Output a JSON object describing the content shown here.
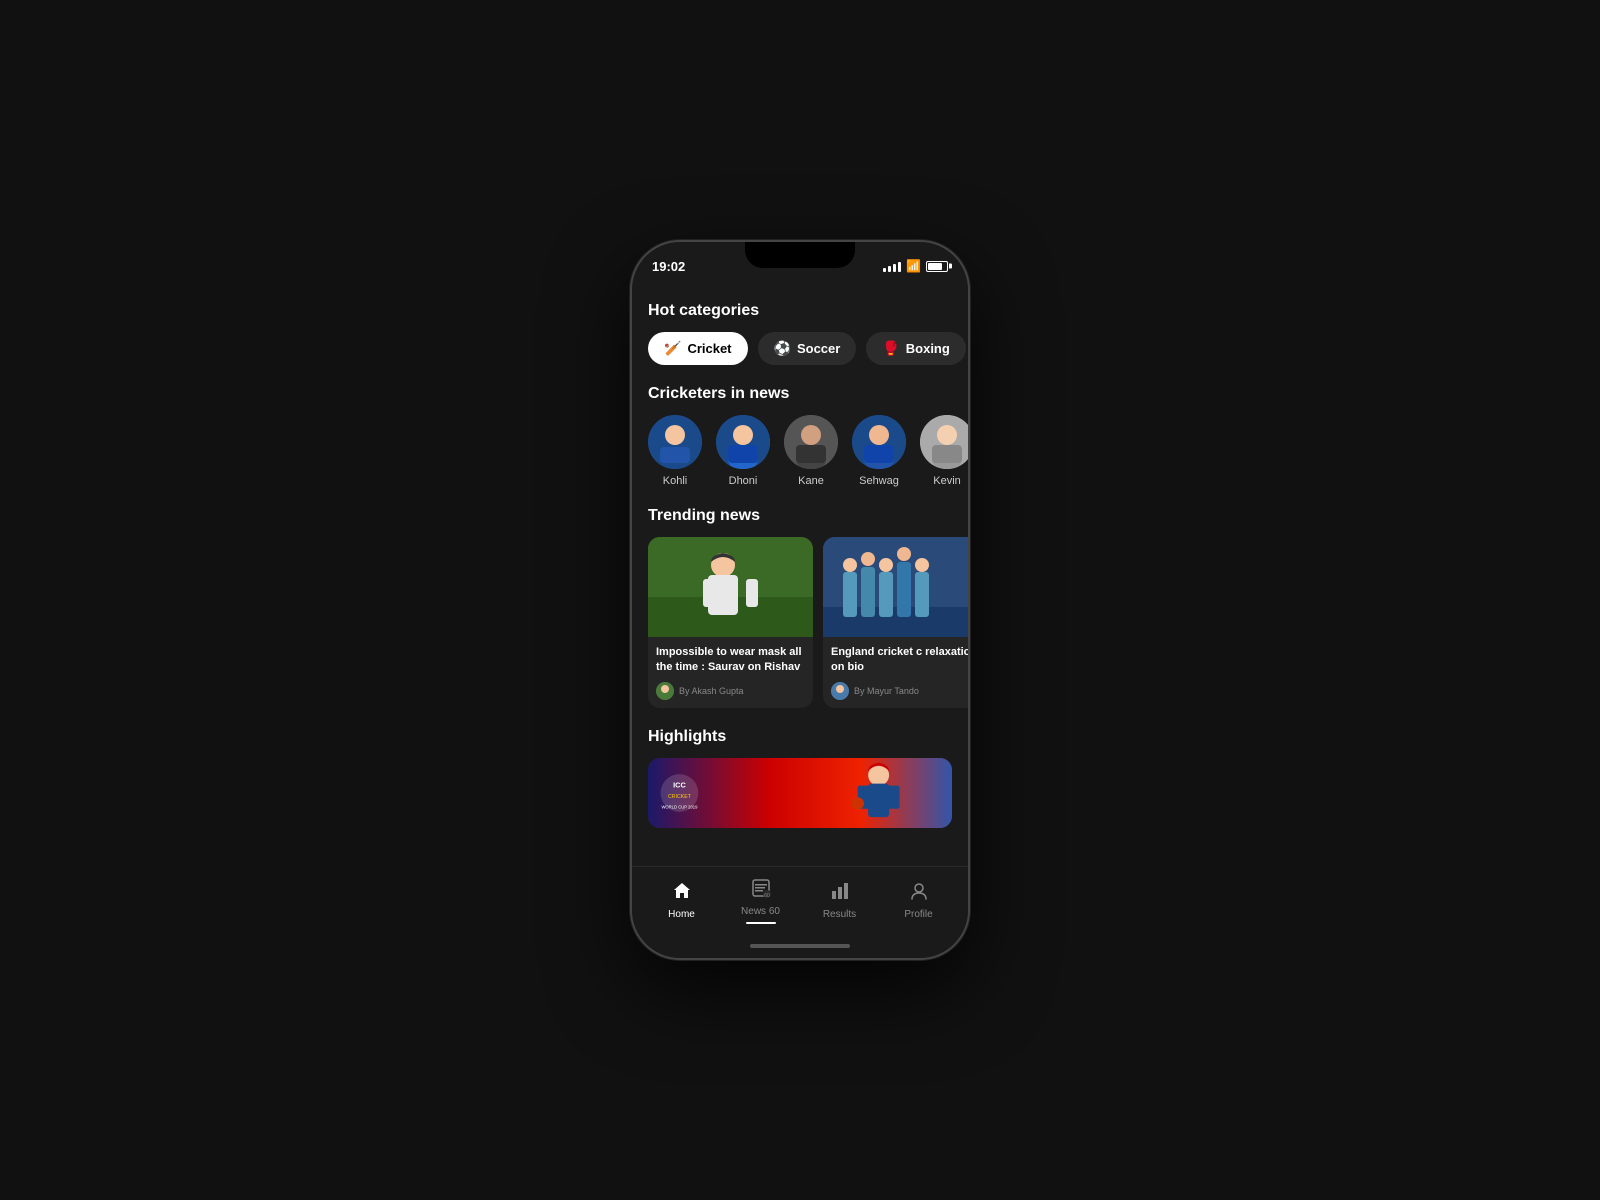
{
  "statusBar": {
    "time": "19:02"
  },
  "header": {
    "hotCategories": "Hot categories"
  },
  "categories": [
    {
      "id": "cricket",
      "label": "Cricket",
      "icon": "🏏",
      "active": true
    },
    {
      "id": "soccer",
      "label": "Soccer",
      "icon": "⚽",
      "active": false
    },
    {
      "id": "boxing",
      "label": "Boxing",
      "icon": "🥊",
      "active": false
    }
  ],
  "cricketersSection": {
    "title": "Cricketers in news",
    "players": [
      {
        "name": "Kohli",
        "avatarClass": "avatar-kohli"
      },
      {
        "name": "Dhoni",
        "avatarClass": "avatar-dhoni"
      },
      {
        "name": "Kane",
        "avatarClass": "avatar-kane"
      },
      {
        "name": "Sehwag",
        "avatarClass": "avatar-sehwag"
      },
      {
        "name": "Kevin",
        "avatarClass": "avatar-kevin"
      }
    ]
  },
  "trendingSection": {
    "title": "Trending news",
    "articles": [
      {
        "title": "Impossible to wear mask all the time : Saurav on Rishav",
        "author": "By Akash Gupta",
        "imageClass": "image1"
      },
      {
        "title": "England cricket c relaxation on bio",
        "author": "By Mayur Tando",
        "imageClass": "image2"
      }
    ]
  },
  "highlightsSection": {
    "title": "Highlights"
  },
  "bottomNav": [
    {
      "id": "home",
      "label": "Home",
      "icon": "⌂",
      "active": true
    },
    {
      "id": "news60",
      "label": "News 60",
      "icon": "📰",
      "active": false
    },
    {
      "id": "results",
      "label": "Results",
      "icon": "📊",
      "active": false
    },
    {
      "id": "profile",
      "label": "Profile",
      "icon": "👤",
      "active": false
    }
  ]
}
